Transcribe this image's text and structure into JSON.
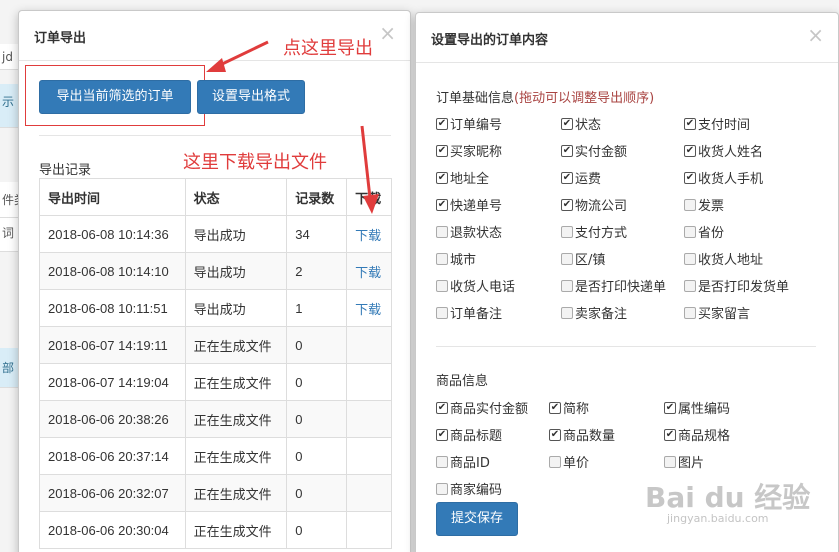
{
  "background": {
    "strips": [
      "jd",
      "示",
      "件类",
      "词",
      "部"
    ]
  },
  "export_modal": {
    "title": "订单导出",
    "close": "×",
    "buttons": {
      "export_current": "导出当前筛选的订单",
      "export_format": "设置导出格式"
    },
    "records_title": "导出记录",
    "columns": [
      "导出时间",
      "状态",
      "记录数",
      "下载"
    ],
    "rows": [
      {
        "time": "2018-06-08 10:14:36",
        "status": "导出成功",
        "count": "34",
        "download": "下载"
      },
      {
        "time": "2018-06-08 10:14:10",
        "status": "导出成功",
        "count": "2",
        "download": "下载"
      },
      {
        "time": "2018-06-08 10:11:51",
        "status": "导出成功",
        "count": "1",
        "download": "下载"
      },
      {
        "time": "2018-06-07 14:19:11",
        "status": "正在生成文件",
        "count": "0",
        "download": ""
      },
      {
        "time": "2018-06-07 14:19:04",
        "status": "正在生成文件",
        "count": "0",
        "download": ""
      },
      {
        "time": "2018-06-06 20:38:26",
        "status": "正在生成文件",
        "count": "0",
        "download": ""
      },
      {
        "time": "2018-06-06 20:37:14",
        "status": "正在生成文件",
        "count": "0",
        "download": ""
      },
      {
        "time": "2018-06-06 20:32:07",
        "status": "正在生成文件",
        "count": "0",
        "download": ""
      },
      {
        "time": "2018-06-06 20:30:04",
        "status": "正在生成文件",
        "count": "0",
        "download": ""
      }
    ]
  },
  "annotations": {
    "click_export": "点这里导出",
    "download_here": "这里下载导出文件",
    "color": "#e03c3c"
  },
  "settings_modal": {
    "title": "设置导出的订单内容",
    "close": "×",
    "basic_group_label": "订单基础信息",
    "basic_group_hint": "(拖动可以调整导出顺序)",
    "basic_fields": [
      {
        "label": "订单编号",
        "checked": true
      },
      {
        "label": "状态",
        "checked": true
      },
      {
        "label": "支付时间",
        "checked": true
      },
      {
        "label": "买家昵称",
        "checked": true
      },
      {
        "label": "实付金额",
        "checked": true
      },
      {
        "label": "收货人姓名",
        "checked": true
      },
      {
        "label": "地址全",
        "checked": true
      },
      {
        "label": "运费",
        "checked": true
      },
      {
        "label": "收货人手机",
        "checked": true
      },
      {
        "label": "快递单号",
        "checked": true
      },
      {
        "label": "物流公司",
        "checked": true
      },
      {
        "label": "发票",
        "checked": false
      },
      {
        "label": "退款状态",
        "checked": false
      },
      {
        "label": "支付方式",
        "checked": false
      },
      {
        "label": "省份",
        "checked": false
      },
      {
        "label": "城市",
        "checked": false
      },
      {
        "label": "区/镇",
        "checked": false
      },
      {
        "label": "收货人地址",
        "checked": false
      },
      {
        "label": "收货人电话",
        "checked": false
      },
      {
        "label": "是否打印快递单",
        "checked": false
      },
      {
        "label": "是否打印发货单",
        "checked": false
      },
      {
        "label": "订单备注",
        "checked": false
      },
      {
        "label": "卖家备注",
        "checked": false
      },
      {
        "label": "买家留言",
        "checked": false
      }
    ],
    "goods_group_label": "商品信息",
    "goods_fields": [
      {
        "label": "商品实付金额",
        "checked": true
      },
      {
        "label": "简称",
        "checked": true
      },
      {
        "label": "属性编码",
        "checked": true
      },
      {
        "label": "商品标题",
        "checked": true
      },
      {
        "label": "商品数量",
        "checked": true
      },
      {
        "label": "商品规格",
        "checked": true
      },
      {
        "label": "商品ID",
        "checked": false
      },
      {
        "label": "单价",
        "checked": false
      },
      {
        "label": "图片",
        "checked": false
      },
      {
        "label": "商家编码",
        "checked": false
      }
    ],
    "submit": "提交保存"
  },
  "watermark": {
    "main": "Bai du 经验",
    "sub": "jingyan.baidu.com"
  }
}
